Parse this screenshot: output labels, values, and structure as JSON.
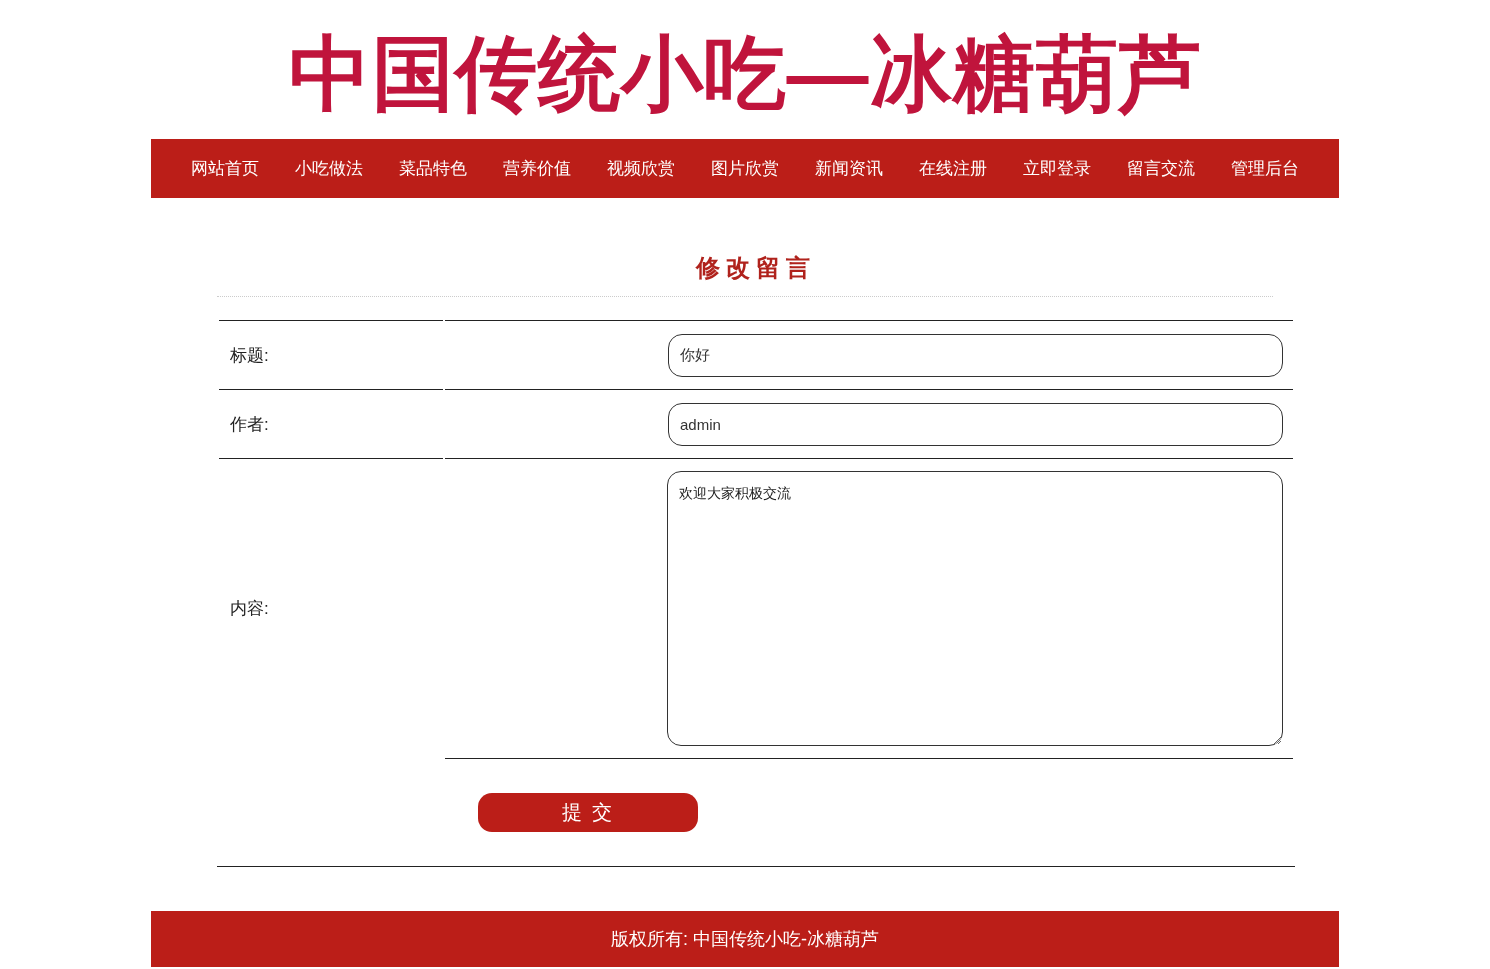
{
  "banner": {
    "title": "中国传统小吃—冰糖葫芦"
  },
  "nav": {
    "items": [
      {
        "label": "网站首页"
      },
      {
        "label": "小吃做法"
      },
      {
        "label": "菜品特色"
      },
      {
        "label": "营养价值"
      },
      {
        "label": "视频欣赏"
      },
      {
        "label": "图片欣赏"
      },
      {
        "label": "新闻资讯"
      },
      {
        "label": "在线注册"
      },
      {
        "label": "立即登录"
      },
      {
        "label": "留言交流"
      },
      {
        "label": "管理后台"
      }
    ]
  },
  "page_title": "修改留言",
  "form": {
    "fields": [
      {
        "label": "标题:",
        "kind": "input",
        "value": "你好"
      },
      {
        "label": "作者:",
        "kind": "input",
        "value": "admin"
      },
      {
        "label": "内容:",
        "kind": "textarea",
        "value": "欢迎大家积极交流"
      }
    ],
    "submit_button": "提 交"
  },
  "footer": {
    "text": "版权所有: 中国传统小吃-冰糖葫芦"
  }
}
